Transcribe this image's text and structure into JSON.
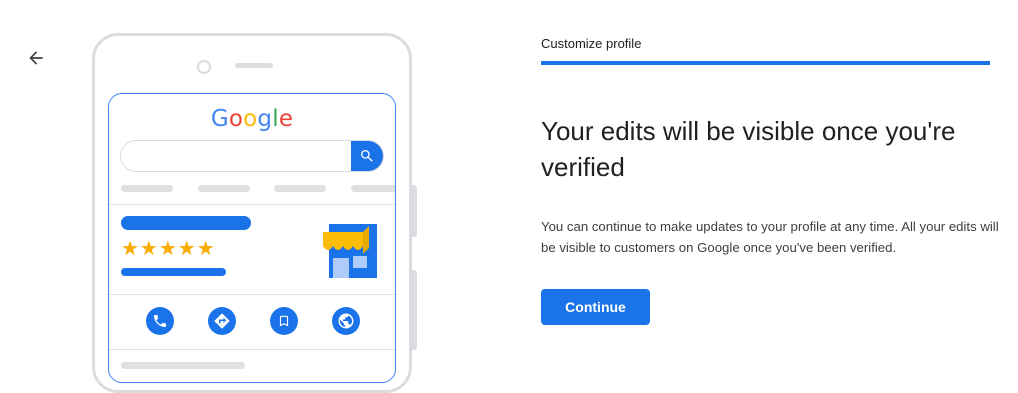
{
  "header": {
    "step_label": "Customize profile",
    "progress_fraction": 1.0
  },
  "main": {
    "title": "Your edits will be visible once you're verified",
    "description": "You can continue to make updates to your profile at any time. All your edits will be visible to customers on Google once you've been verified.",
    "continue_label": "Continue"
  },
  "illustration": {
    "logo_letters": [
      "G",
      "o",
      "o",
      "g",
      "l",
      "e"
    ],
    "logo_colors": [
      "#4285f4",
      "#ea4335",
      "#fbbc05",
      "#4285f4",
      "#34a853",
      "#ea4335"
    ],
    "stars": "★★★★★",
    "rating_stars": 5,
    "action_icons": [
      "phone-icon",
      "directions-icon",
      "bookmark-icon",
      "website-icon"
    ]
  },
  "colors": {
    "accent": "#1a73e8",
    "star": "#f9ab00",
    "awning": "#fbbc05"
  },
  "icons": {
    "back": "arrow-back-icon",
    "search": "search-icon"
  }
}
